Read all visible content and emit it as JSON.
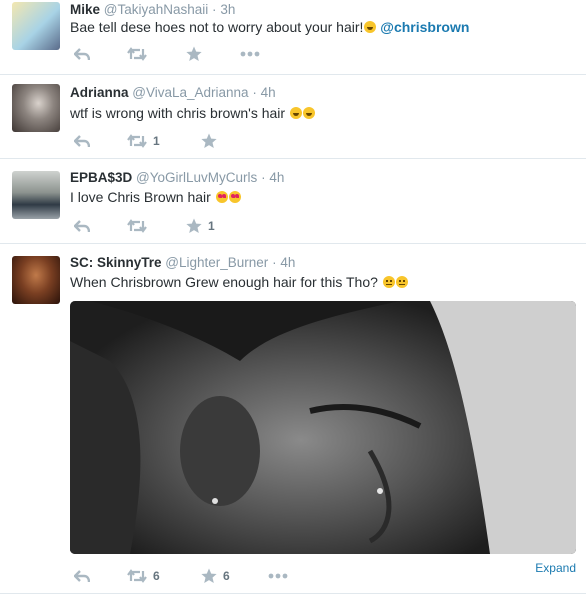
{
  "tweets": [
    {
      "name": "Mike",
      "handle": "@TakiyahNashaii",
      "time": "3h",
      "text": "Bae tell dese hoes not to worry about your hair!",
      "emoji": "sweat-smile",
      "mention": "@chrisbrown",
      "retweets": "",
      "favorites": ""
    },
    {
      "name": "Adrianna",
      "handle": "@VivaLa_Adrianna",
      "time": "4h",
      "text": "wtf is wrong with chris brown's hair",
      "emoji": "tears-of-joy x2",
      "retweets": "1",
      "favorites": ""
    },
    {
      "name": "EPBA$3D",
      "handle": "@YoGirlLuvMyCurls",
      "time": "4h",
      "text": "I love Chris Brown hair",
      "emoji": "heart-eyes x2",
      "retweets": "",
      "favorites": "1"
    },
    {
      "name": "SC: SkinnyTre",
      "handle": "@Lighter_Burner",
      "time": "4h",
      "text": "When Chrisbrown Grew enough hair for this Tho?",
      "emoji": "neutral x2",
      "retweets": "6",
      "favorites": "6",
      "expand_label": "Expand"
    }
  ],
  "separator": "·",
  "colors": {
    "link": "#1b7ab0",
    "muted": "#8899a6",
    "icon": "#aab8c2"
  }
}
